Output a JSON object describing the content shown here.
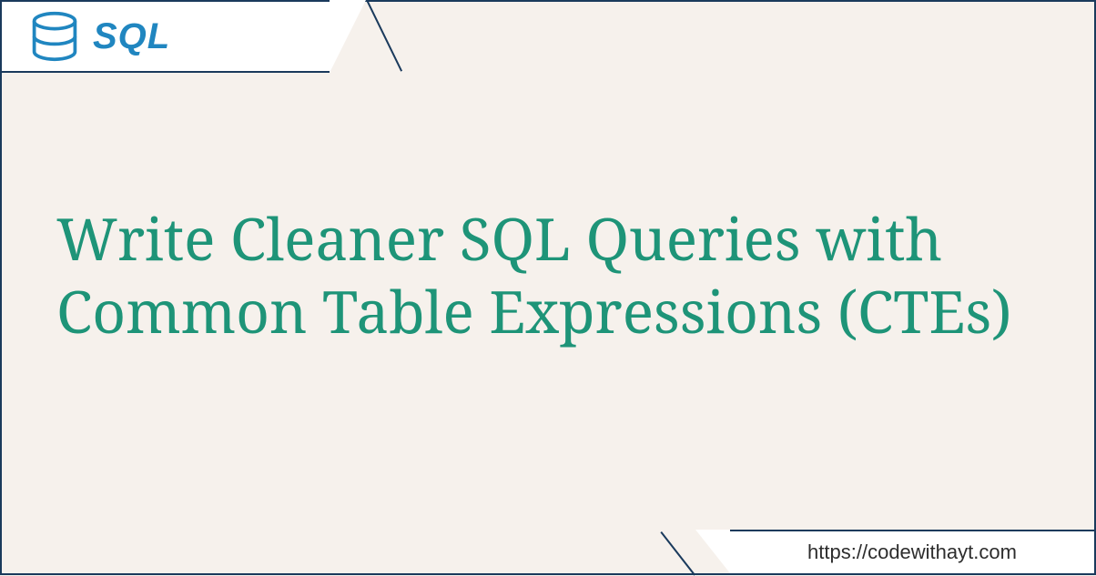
{
  "logo": {
    "text": "SQL",
    "iconName": "database-icon"
  },
  "title": "Write Cleaner SQL Queries with Common Table Expressions (CTEs)",
  "footer": {
    "url": "https://codewithayt.com"
  },
  "colors": {
    "background": "#f6f1ec",
    "border": "#1a3a5c",
    "title": "#1e9478",
    "logoText": "#2086c0",
    "logoIcon": "#2086c0"
  }
}
